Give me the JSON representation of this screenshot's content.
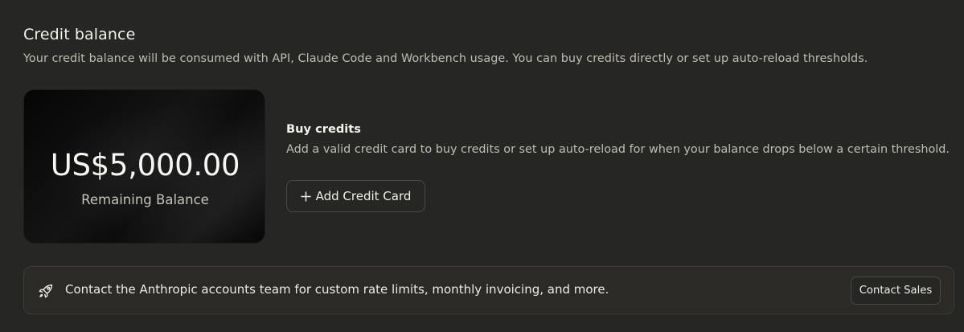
{
  "section": {
    "title": "Credit balance",
    "subtitle": "Your credit balance will be consumed with API, Claude Code and Workbench usage. You can buy credits directly or set up auto-reload thresholds."
  },
  "balance_card": {
    "amount": "US$5,000.00",
    "label": "Remaining Balance"
  },
  "buy_credits": {
    "title": "Buy credits",
    "description": "Add a valid credit card to buy credits or set up auto-reload for when your balance drops below a certain threshold.",
    "button_icon": "plus-icon",
    "button_label": "Add Credit Card"
  },
  "sales_banner": {
    "icon": "rocket-icon",
    "text": "Contact the Anthropic accounts team for custom rate limits, monthly invoicing, and more.",
    "button_label": "Contact Sales"
  },
  "colors": {
    "background": "#262624",
    "card_background": "#0b0b0b",
    "text_primary": "#f0eee6",
    "text_secondary": "#bfbcb2",
    "border": "#4a4945"
  }
}
